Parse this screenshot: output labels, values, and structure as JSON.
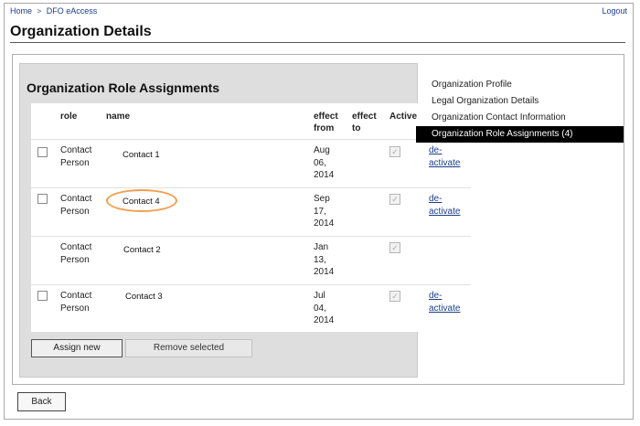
{
  "breadcrumb": {
    "home": "Home",
    "separator": ">",
    "current": "DFO eAccess"
  },
  "header": {
    "logout": "Logout",
    "page_title": "Organization Details"
  },
  "section": {
    "title": "Organization Role Assignments"
  },
  "table": {
    "columns": {
      "role": "role",
      "name": "name",
      "effect_from": [
        "effect",
        "from"
      ],
      "effect_to": [
        "effect",
        "to"
      ],
      "active": "Active"
    },
    "rows": [
      {
        "role": [
          "Contact",
          "Person"
        ],
        "name": "Contact 1",
        "effect_from": [
          "Aug",
          "06,",
          "2014"
        ],
        "has_checkbox": true,
        "active": true,
        "action": [
          "de-",
          "activate"
        ]
      },
      {
        "role": [
          "Contact",
          "Person"
        ],
        "name": "Contact 4",
        "effect_from": [
          "Sep",
          "17,",
          "2014"
        ],
        "has_checkbox": true,
        "active": true,
        "action": [
          "de-",
          "activate"
        ],
        "highlighted": true
      },
      {
        "role": [
          "Contact",
          "Person"
        ],
        "name": "Contact 2",
        "effect_from": [
          "Jan",
          "13,",
          "2014"
        ],
        "has_checkbox": false,
        "active": true,
        "action": null
      },
      {
        "role": [
          "Contact",
          "Person"
        ],
        "name": "Contact 3",
        "effect_from": [
          "Jul",
          "04,",
          "2014"
        ],
        "has_checkbox": true,
        "active": true,
        "action": [
          "de-",
          "activate"
        ]
      }
    ]
  },
  "buttons": {
    "assign_new": "Assign new",
    "remove_selected": "Remove selected",
    "back": "Back"
  },
  "side_nav": {
    "items": [
      {
        "label": "Organization Profile",
        "active": false
      },
      {
        "label": "Legal Organization Details",
        "active": false
      },
      {
        "label": "Organization Contact Information",
        "active": false
      },
      {
        "label": "Organization Role Assignments (4)",
        "active": true
      }
    ]
  },
  "colors": {
    "link": "#1a3d8a",
    "highlight": "#f0a050",
    "active_nav_bg": "#000000",
    "panel_bg": "#dedede"
  },
  "icons": {
    "breadcrumb_separator": "chevron-right-icon",
    "active_check": "check-icon"
  }
}
